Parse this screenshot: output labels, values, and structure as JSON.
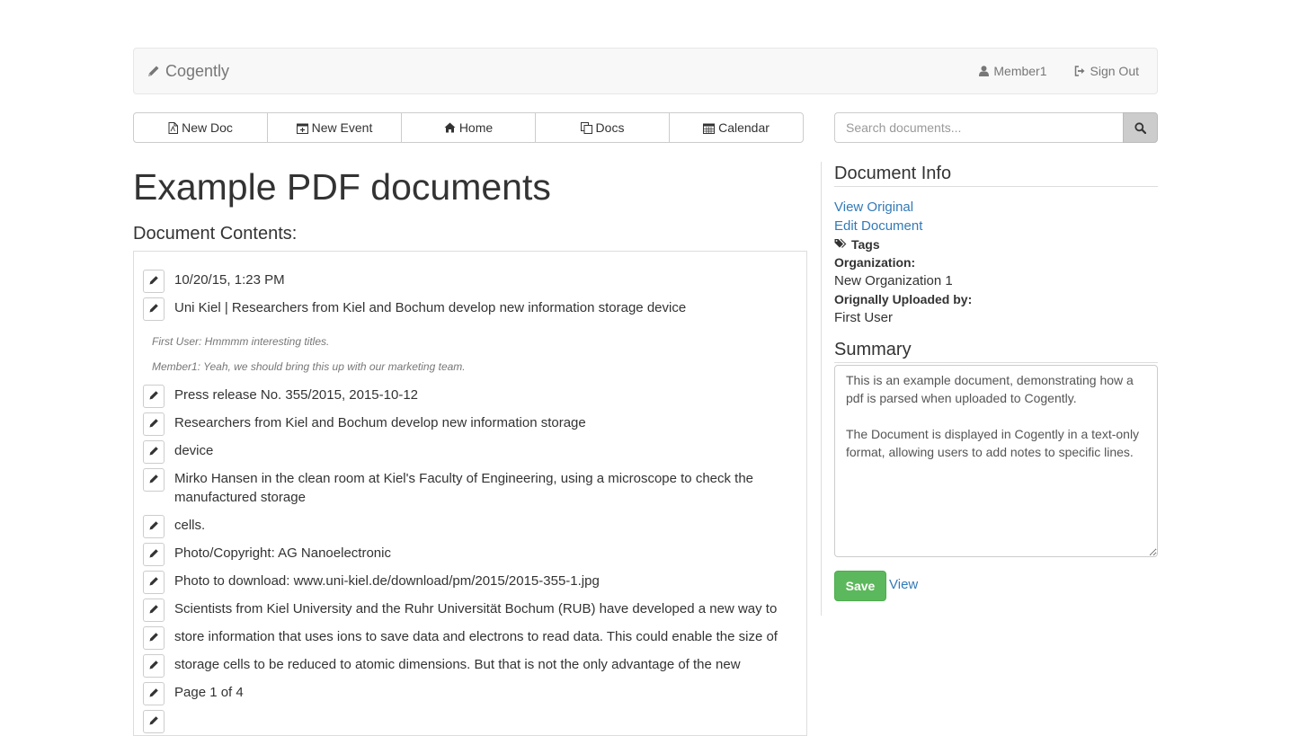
{
  "navbar": {
    "brand": "Cogently",
    "brand_icon": "pencil-icon",
    "user_label": "Member1",
    "signout_label": "Sign Out"
  },
  "toolbar": {
    "buttons": [
      {
        "label": "New Doc",
        "icon": "pdf-file-icon"
      },
      {
        "label": "New Event",
        "icon": "calendar-plus-icon"
      },
      {
        "label": "Home",
        "icon": "home-icon"
      },
      {
        "label": "Docs",
        "icon": "copy-docs-icon"
      },
      {
        "label": "Calendar",
        "icon": "calendar-icon"
      }
    ]
  },
  "search": {
    "placeholder": "Search documents..."
  },
  "page": {
    "title": "Example PDF documents",
    "contents_heading": "Document Contents:"
  },
  "lines": [
    "10/20/15, 1:23 PM",
    "Uni Kiel | Researchers from Kiel and Bochum develop new information storage device",
    "Press release No. 355/2015, 2015-10-12",
    "Researchers from Kiel and Bochum develop new information storage",
    "device",
    "Mirko Hansen in the clean room at Kiel's Faculty of Engineering, using a microscope to check the manufactured storage",
    "cells.",
    "Photo/Copyright: AG Nanoelectronic",
    "Photo to download: www.uni-kiel.de/download/pm/2015/2015-355-1.jpg",
    "Scientists from Kiel University and the Ruhr Universität Bochum (RUB) have developed a new way to",
    "store information that uses ions to save data and electrons to read data. This could enable the size of",
    "storage cells to be reduced to atomic dimensions. But that is not the only advantage of the new",
    "Page 1 of 4"
  ],
  "notes": [
    "First User: Hmmmm interesting titles.",
    "Member1: Yeah, we should bring this up with our marketing team."
  ],
  "sidebar": {
    "info_heading": "Document Info",
    "view_original": "View Original",
    "edit_document": "Edit Document",
    "tags_label": "Tags",
    "organization_label": "Organization:",
    "organization_value": "New Organization 1",
    "uploaded_label": "Orignally Uploaded by:",
    "uploaded_value": "First User",
    "summary_heading": "Summary",
    "summary_text": "This is an example document, demonstrating how a pdf is parsed when uploaded to Cogently.\n\nThe Document is displayed in Cogently in a text-only format, allowing users to add notes to specific lines.",
    "save_label": "Save",
    "view_label": "View"
  },
  "colors": {
    "link": "#337ab7",
    "save": "#5cb85c",
    "navbar_bg": "#f8f8f8"
  }
}
